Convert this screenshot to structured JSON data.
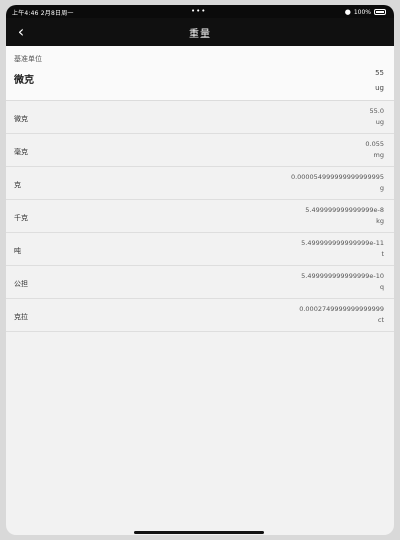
{
  "status": {
    "time_date": "上午4:46  2月8日周一",
    "dots": "•••",
    "battery_percent": "100%"
  },
  "nav": {
    "back_icon": "chevron-left-icon",
    "title": "重量"
  },
  "base": {
    "label": "基准单位",
    "unit_name": "微克",
    "value": "55",
    "unit": "ug"
  },
  "rows": [
    {
      "name": "微克",
      "value": "55.0",
      "unit": "ug"
    },
    {
      "name": "毫克",
      "value": "0.055",
      "unit": "mg"
    },
    {
      "name": "克",
      "value": "0.000054999999999999995",
      "unit": "g"
    },
    {
      "name": "千克",
      "value": "5.499999999999999e-8",
      "unit": "kg"
    },
    {
      "name": "吨",
      "value": "5.499999999999999e-11",
      "unit": "t"
    },
    {
      "name": "公担",
      "value": "5.499999999999999e-10",
      "unit": "q"
    },
    {
      "name": "克拉",
      "value": "0.0002749999999999999",
      "unit": "ct"
    }
  ]
}
